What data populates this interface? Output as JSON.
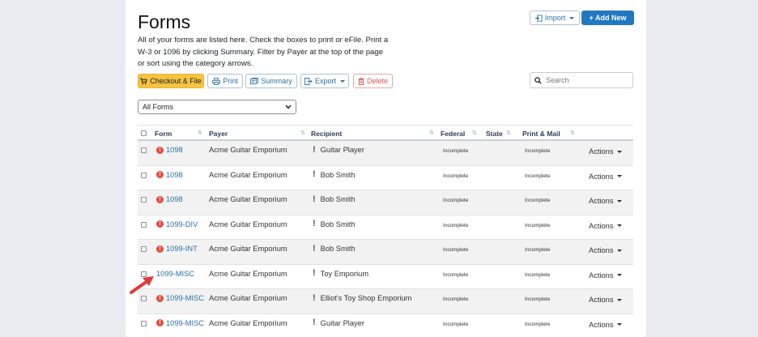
{
  "header": {
    "title": "Forms",
    "intro": "All of your forms are listed here. Check the boxes to print or eFile. Print a W-3 or 1096 by clicking Summary. Filter by Payer at the top of the page or sort using the category arrows.",
    "import_label": "Import",
    "add_new_label": "+ Add New"
  },
  "toolbar": {
    "checkout_label": "Checkout & File",
    "print_label": "Print",
    "summary_label": "Summary",
    "export_label": "Export",
    "delete_label": "Delete"
  },
  "search": {
    "placeholder": "Search"
  },
  "filter": {
    "selected": "All Forms"
  },
  "table": {
    "columns": [
      "Form",
      "Payer",
      "Recipient",
      "Federal",
      "State",
      "Print & Mail"
    ],
    "rows": [
      {
        "form": "1098",
        "payer": "Acme Guitar Emporium",
        "recipient": "Guitar Player",
        "federal": "Incomplete",
        "print_mail": "Incomplete",
        "actions": "Actions",
        "alert": true
      },
      {
        "form": "1098",
        "payer": "Acme Guitar Emporium",
        "recipient": "Bob Smith",
        "federal": "Incomplete",
        "print_mail": "Incomplete",
        "actions": "Actions",
        "alert": true
      },
      {
        "form": "1098",
        "payer": "Acme Guitar Emporium",
        "recipient": "Bob Smith",
        "federal": "Incomplete",
        "print_mail": "Incomplete",
        "actions": "Actions",
        "alert": true
      },
      {
        "form": "1099-DIV",
        "payer": "Acme Guitar Emporium",
        "recipient": "Bob Smith",
        "federal": "Incomplete",
        "print_mail": "Incomplete",
        "actions": "Actions",
        "alert": true
      },
      {
        "form": "1099-INT",
        "payer": "Acme Guitar Emporium",
        "recipient": "Bob Smith",
        "federal": "Incomplete",
        "print_mail": "Incomplete",
        "actions": "Actions",
        "alert": true
      },
      {
        "form": "1099-MISC",
        "payer": "Acme Guitar Emporium",
        "recipient": "Toy Emporium",
        "federal": "Incomplete",
        "print_mail": "Incomplete",
        "actions": "Actions",
        "alert": false
      },
      {
        "form": "1099-MISC",
        "payer": "Acme Guitar Emporium",
        "recipient": "Elliot's Toy Shop Emporium",
        "federal": "Incomplete",
        "print_mail": "Incomplete",
        "actions": "Actions",
        "alert": true
      },
      {
        "form": "1099-MISC",
        "payer": "Acme Guitar Emporium",
        "recipient": "Guitar Player",
        "federal": "Incomplete",
        "print_mail": "Incomplete",
        "actions": "Actions",
        "alert": true
      }
    ]
  },
  "colors": {
    "accent": "#1f78c1",
    "checkout": "#f6c343",
    "delete": "#d9534f",
    "alert": "#e74c3c",
    "arrow": "#e53935"
  }
}
